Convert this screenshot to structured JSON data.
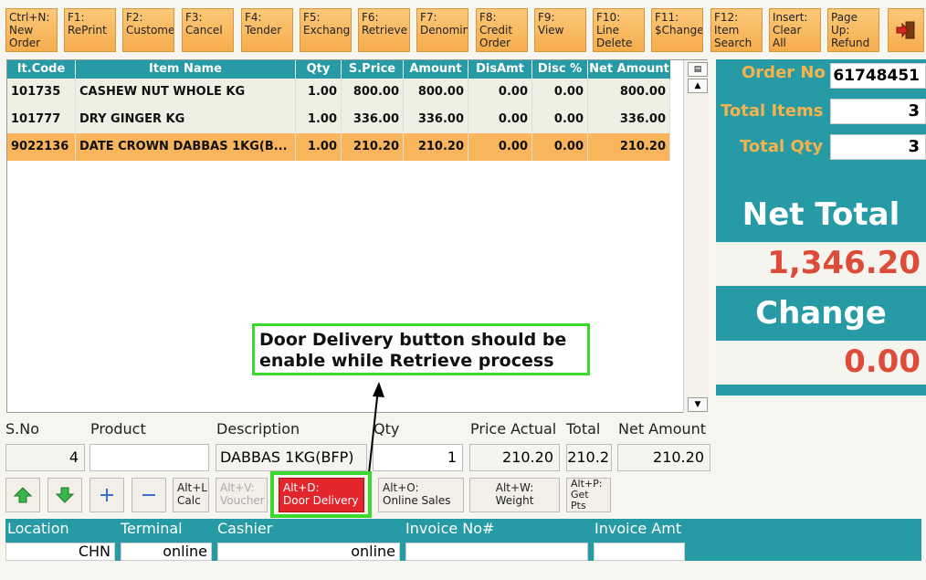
{
  "toolbar": [
    {
      "label": "Ctrl+N:\nNew\nOrder"
    },
    {
      "label": "F1:\nRePrint"
    },
    {
      "label": "F2:\nCustome"
    },
    {
      "label": "F3:\nCancel"
    },
    {
      "label": "F4:\nTender"
    },
    {
      "label": "F5:\nExchang"
    },
    {
      "label": "F6:\nRetrieve"
    },
    {
      "label": "F7:\nDenomin"
    },
    {
      "label": "F8:\nCredit\nOrder"
    },
    {
      "label": "F9:\nView"
    },
    {
      "label": "F10:\nLine\nDelete"
    },
    {
      "label": "F11:\n$Change"
    },
    {
      "label": "F12:\nItem\nSearch"
    },
    {
      "label": "Insert:\nClear All"
    },
    {
      "label": "Page\nUp:\nRefund"
    }
  ],
  "grid": {
    "headers": [
      "It.Code",
      "Item Name",
      "Qty",
      "S.Price",
      "Amount",
      "DisAmt",
      "Disc %",
      "Net Amount"
    ],
    "rows": [
      [
        "101735",
        "CASHEW NUT WHOLE KG",
        "1.00",
        "800.00",
        "800.00",
        "0.00",
        "0.00",
        "800.00"
      ],
      [
        "101777",
        "DRY GINGER KG",
        "1.00",
        "336.00",
        "336.00",
        "0.00",
        "0.00",
        "336.00"
      ],
      [
        "9022136",
        "DATE CROWN DABBAS 1KG(B...",
        "1.00",
        "210.20",
        "210.20",
        "0.00",
        "0.00",
        "210.20"
      ]
    ]
  },
  "summary": {
    "order_no_label": "Order No",
    "order_no": "61748451",
    "total_items_label": "Total Items",
    "total_items": "3",
    "total_qty_label": "Total Qty",
    "total_qty": "3",
    "net_total_label": "Net Total",
    "net_total": "1,346.20",
    "change_label": "Change",
    "change": "0.00"
  },
  "entry": {
    "sno_label": "S.No",
    "sno": "4",
    "product_label": "Product",
    "product": "",
    "description_label": "Description",
    "description": "DABBAS 1KG(BFP)",
    "qty_label": "Qty",
    "qty": "1",
    "price_actual_label": "Price Actual",
    "price_actual": "210.20",
    "total_label": "Total",
    "total": "210.2",
    "net_amount_label": "Net Amount",
    "net_amount": "210.20"
  },
  "actions": {
    "calc": "Alt+L:\nCalc",
    "voucher": "Alt+V:\nVoucher",
    "door_delivery": "Alt+D:\nDoor Delivery",
    "online_sales": "Alt+O:\nOnline Sales",
    "weight": "Alt+W:\nWeight",
    "get_pts": "Alt+P:\nGet\nPts"
  },
  "footer": {
    "location_label": "Location",
    "location": "CHN",
    "terminal_label": "Terminal",
    "terminal": "online",
    "cashier_label": "Cashier",
    "cashier": "online",
    "invoice_no_label": "Invoice No#",
    "invoice_no": "",
    "invoice_amt_label": "Invoice Amt",
    "invoice_amt": ""
  },
  "annotation": {
    "text": "Door Delivery button should be enable while Retrieve process"
  },
  "colors": {
    "accent": "#269aa5",
    "button": "#f6ac4b",
    "highlight_row": "#f8b55c",
    "alert": "#e2262b",
    "callout_border": "#3bd82e"
  }
}
